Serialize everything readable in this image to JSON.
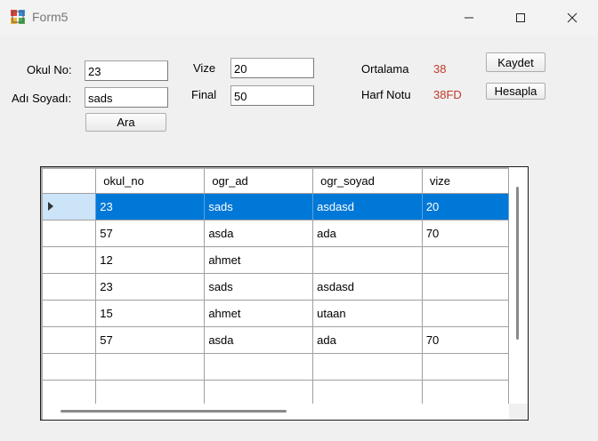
{
  "window": {
    "title": "Form5",
    "icon": "winforms-app-icon"
  },
  "form": {
    "okul_no_label": "Okul No:",
    "okul_no_value": "23",
    "adi_soyadi_label": "Adı Soyadı:",
    "adi_soyadi_value": "sads",
    "ara_label": "Ara",
    "vize_label": "Vize",
    "vize_value": "20",
    "final_label": "Final",
    "final_value": "50",
    "ortalama_label": "Ortalama",
    "ortalama_value": "38",
    "harf_notu_label": "Harf Notu",
    "harf_notu_value": "38FD",
    "kaydet_label": "Kaydet",
    "hesapla_label": "Hesapla",
    "result_color": "#c0392b"
  },
  "grid": {
    "columns": [
      "okul_no",
      "ogr_ad",
      "ogr_soyad",
      "vize"
    ],
    "rows": [
      [
        "23",
        "sads",
        "asdasd",
        "20"
      ],
      [
        "57",
        "asda",
        "ada",
        "70"
      ],
      [
        "12",
        "ahmet",
        "",
        ""
      ],
      [
        "23",
        "sads",
        "asdasd",
        ""
      ],
      [
        "15",
        "ahmet",
        "utaan",
        ""
      ],
      [
        "57",
        "asda",
        "ada",
        "70"
      ],
      [
        "",
        "",
        "",
        ""
      ],
      [
        "",
        "",
        "",
        ""
      ]
    ],
    "selected_row": 0,
    "selection_color": "#0078d7"
  }
}
